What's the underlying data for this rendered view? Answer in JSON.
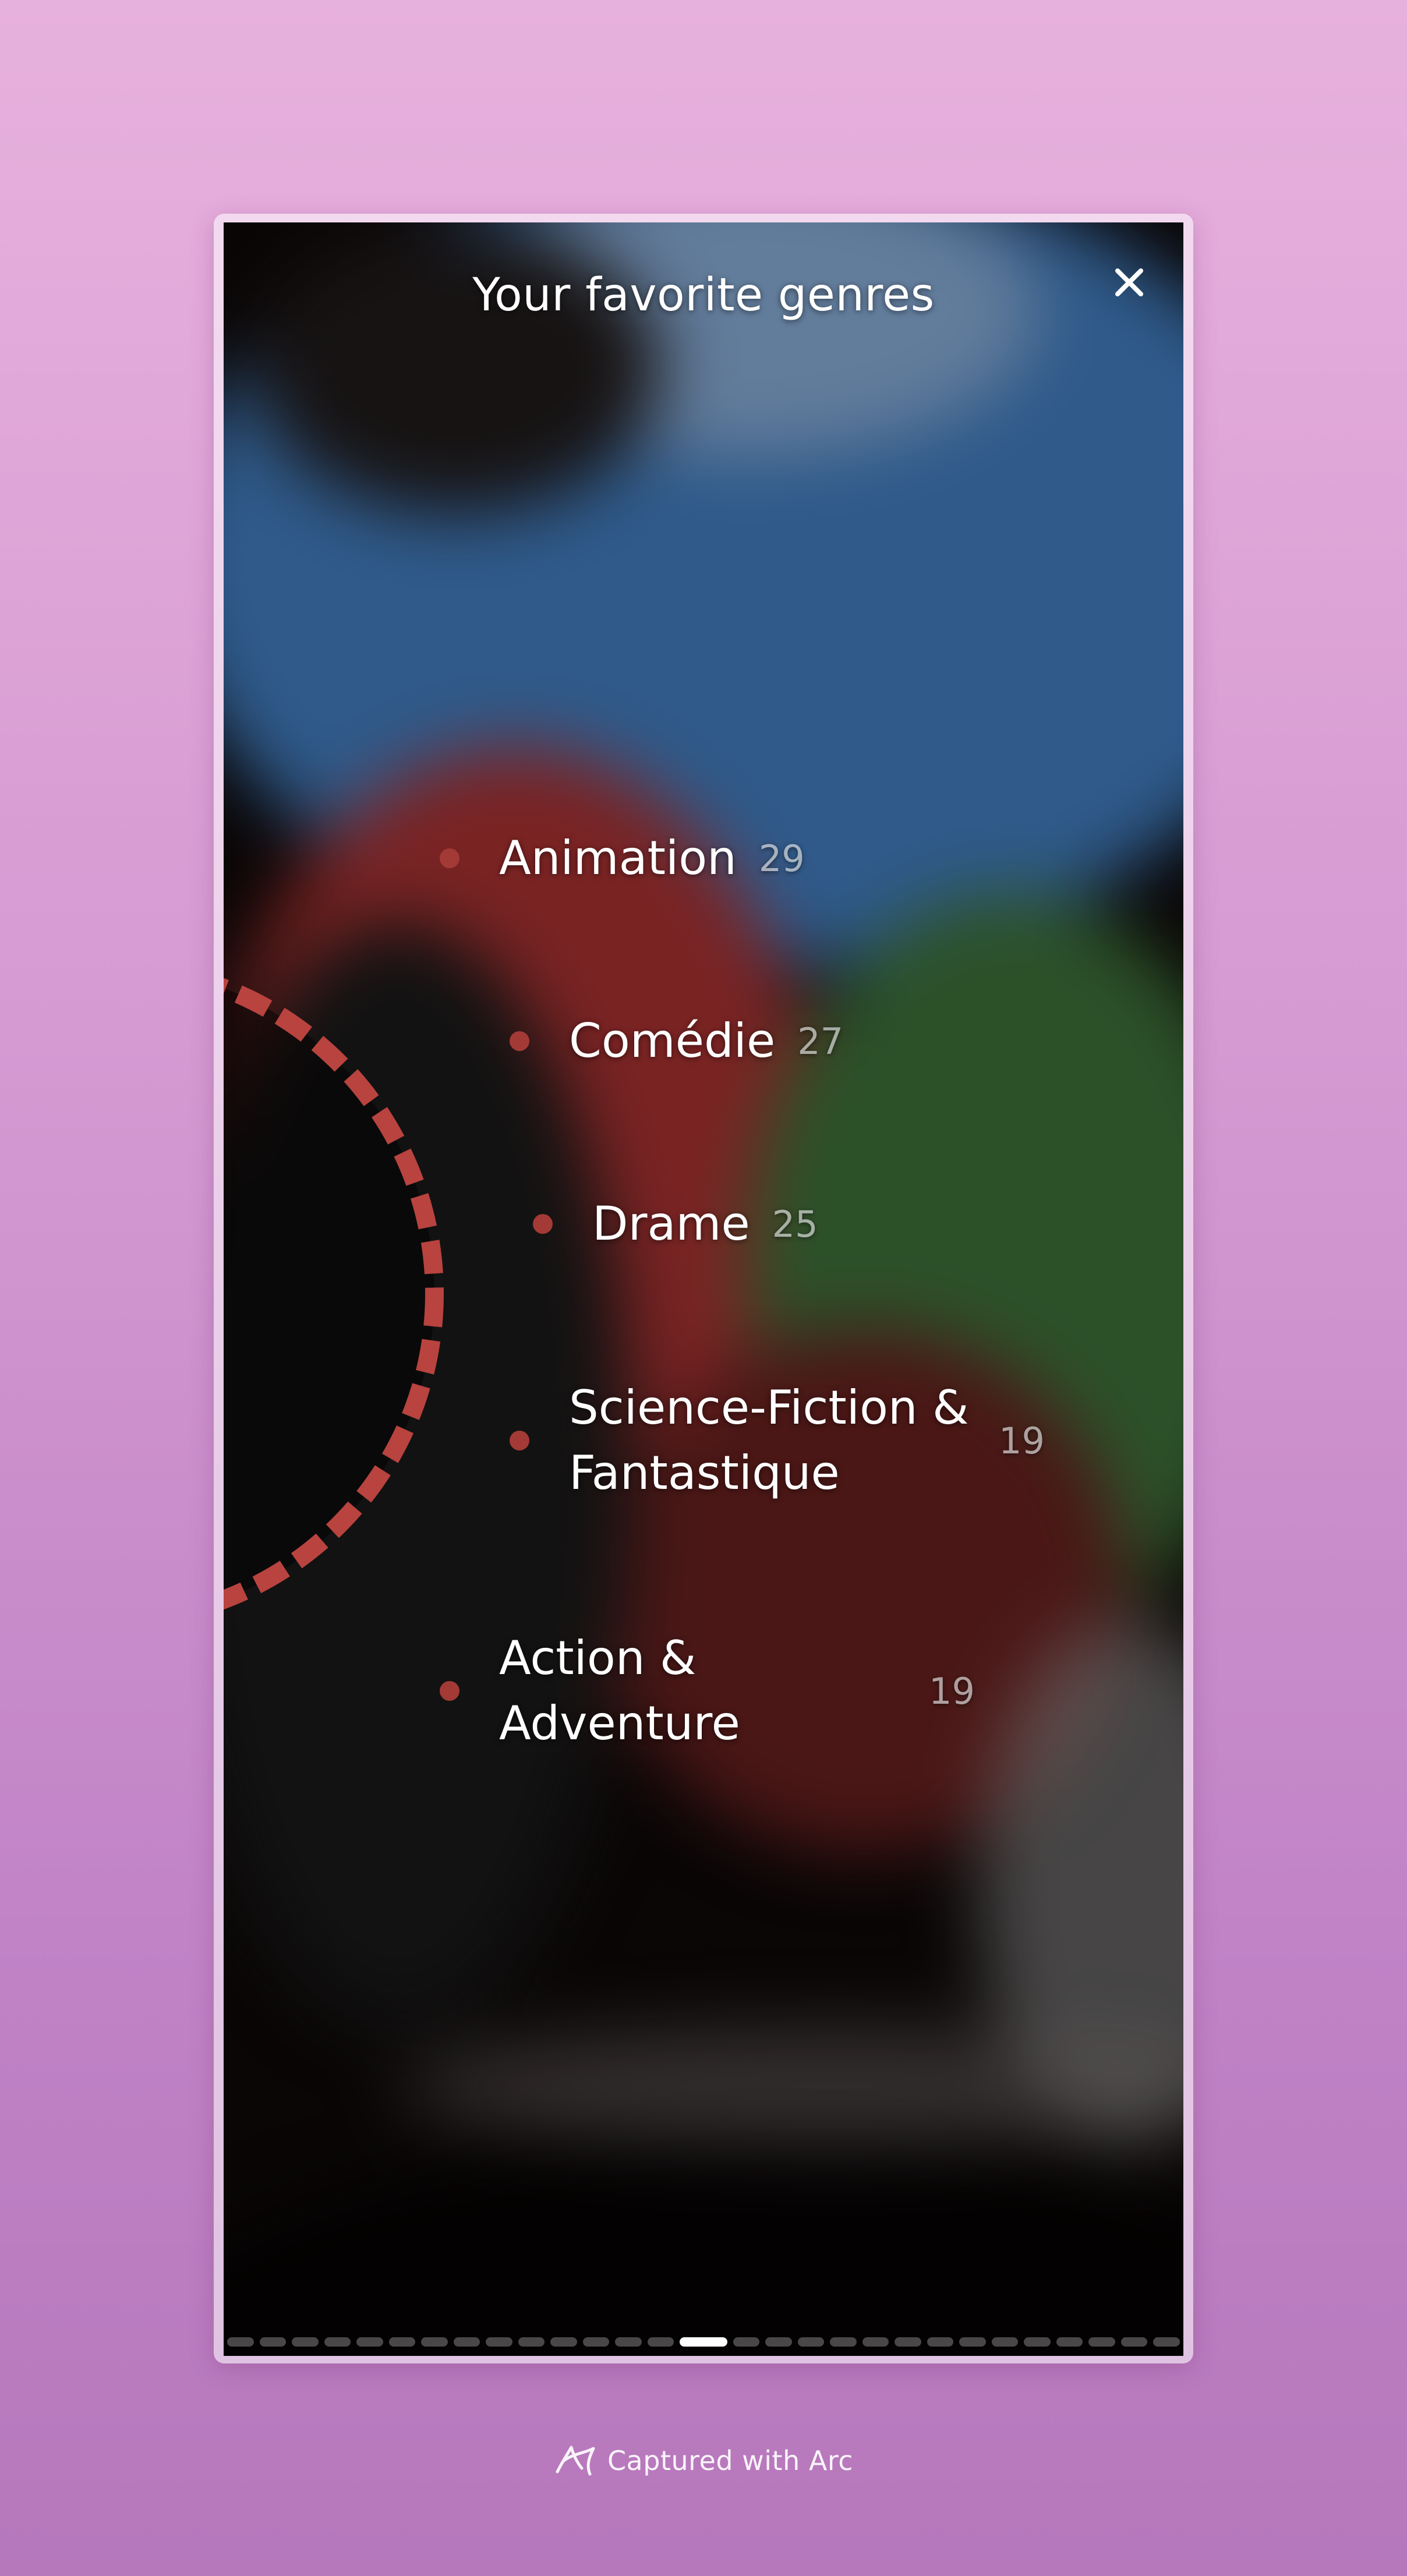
{
  "story": {
    "title": "Your favorite genres",
    "close_icon": "close-icon",
    "accent_color": "#b8433f",
    "genres": [
      {
        "label": "Animation",
        "count": "29"
      },
      {
        "label": "Comédie",
        "count": "27"
      },
      {
        "label": "Drame",
        "count": "25"
      },
      {
        "label": "Science-Fiction &",
        "label_line2": "Fantastique",
        "count": "19"
      },
      {
        "label": "Action &",
        "label_line2": "Adventure",
        "count": "19"
      }
    ],
    "progress": {
      "total_segments": 29,
      "active_segment": 14
    }
  },
  "footer": {
    "icon": "arc-logo-icon",
    "text": "Captured with Arc"
  }
}
